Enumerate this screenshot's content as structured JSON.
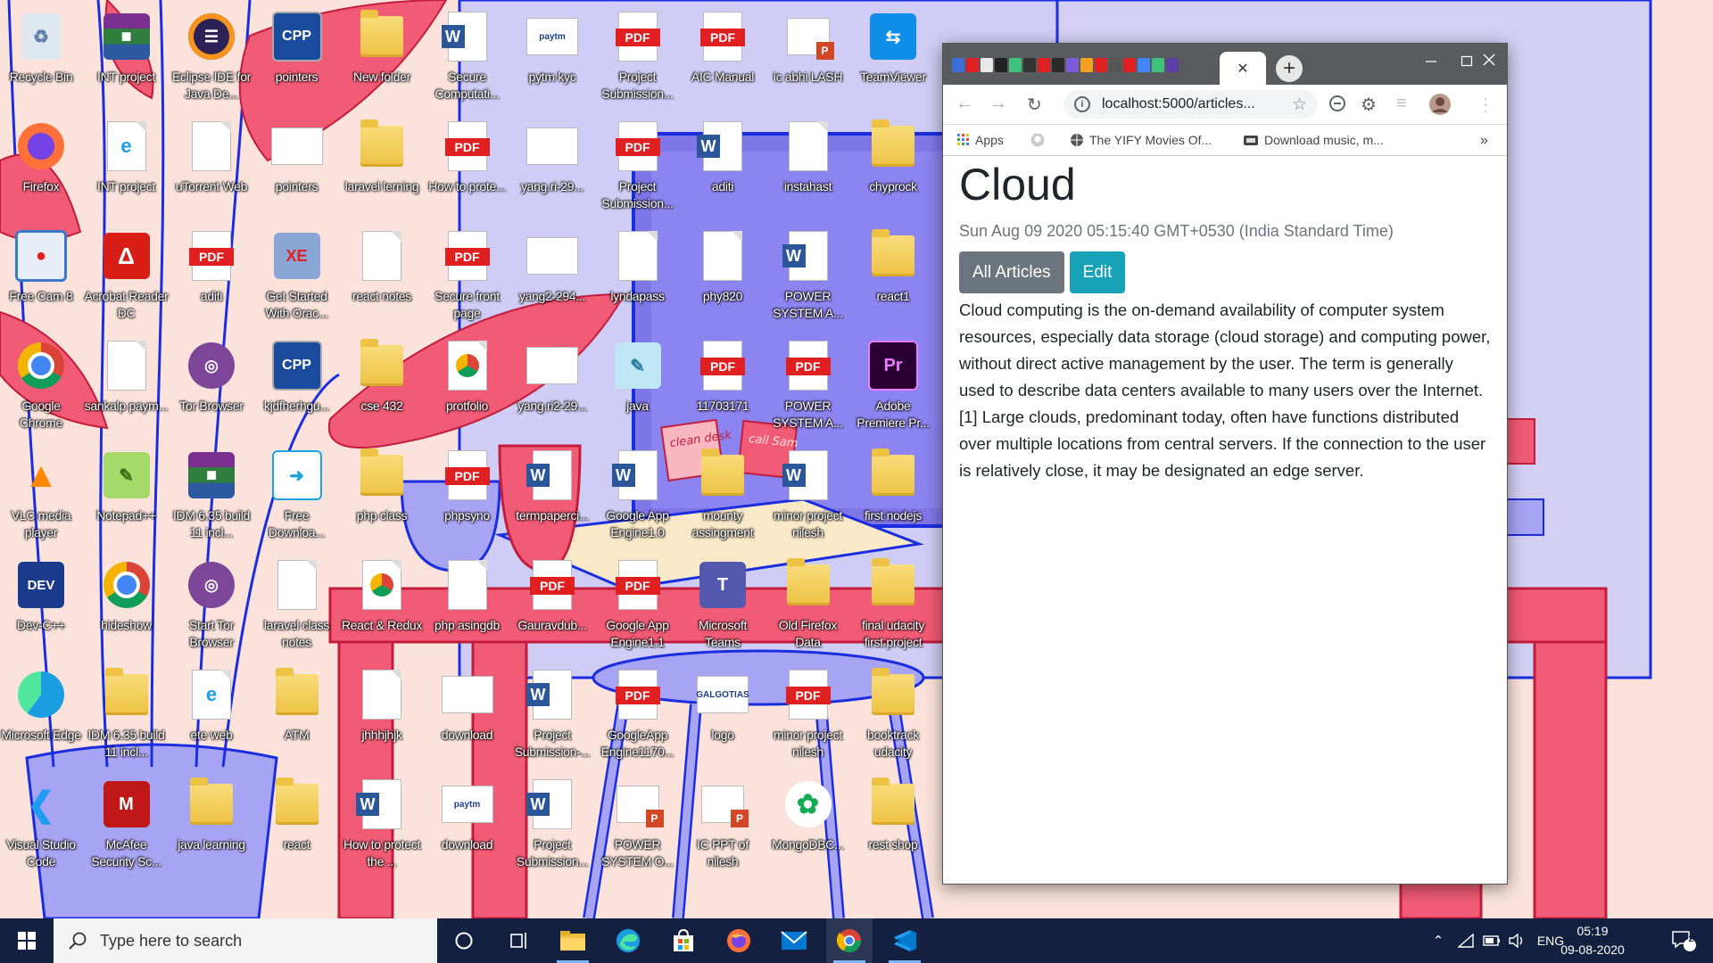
{
  "desktop": {
    "icons": [
      {
        "label": "Recycle Bin",
        "type": "recycle"
      },
      {
        "label": "INT project",
        "type": "winrar"
      },
      {
        "label": "Eclipse IDE for Java De...",
        "type": "eclipse"
      },
      {
        "label": "pointers",
        "type": "cpp"
      },
      {
        "label": "New folder",
        "type": "folder"
      },
      {
        "label": "Secure Computati...",
        "type": "word"
      },
      {
        "label": "pytm kyc",
        "type": "image",
        "glyph_text": "paytm"
      },
      {
        "label": "Project Submission...",
        "type": "pdf"
      },
      {
        "label": "AIC Manual",
        "type": "pdf"
      },
      {
        "label": "ic abhi LASH",
        "type": "ppt"
      },
      {
        "label": "TeamViewer",
        "type": "teamviewer"
      },
      {
        "label": "Firefox",
        "type": "firefox"
      },
      {
        "label": "INT project",
        "type": "edgedoc"
      },
      {
        "label": "uTorrent Web",
        "type": "doc"
      },
      {
        "label": "pointers",
        "type": "image",
        "glyph_text": ""
      },
      {
        "label": "laravel lerning",
        "type": "folder"
      },
      {
        "label": "How to prote...",
        "type": "pdf"
      },
      {
        "label": "yang.ri-29...",
        "type": "image",
        "glyph_text": ""
      },
      {
        "label": "Project Submission...",
        "type": "pdf"
      },
      {
        "label": "aditi",
        "type": "word"
      },
      {
        "label": "instahast",
        "type": "doc"
      },
      {
        "label": "chyprock",
        "type": "folder"
      },
      {
        "label": "Free Cam 8",
        "type": "freecam"
      },
      {
        "label": "Acrobat Reader DC",
        "type": "acrobat"
      },
      {
        "label": "aditi",
        "type": "pdf"
      },
      {
        "label": "Get Started With Orac...",
        "type": "oracle"
      },
      {
        "label": "react notes",
        "type": "doc"
      },
      {
        "label": "Secure front page",
        "type": "pdf"
      },
      {
        "label": "yang2-294...",
        "type": "image",
        "glyph_text": ""
      },
      {
        "label": "lyndapass",
        "type": "doc"
      },
      {
        "label": "phy820",
        "type": "doc"
      },
      {
        "label": "POWER SYSTEM A...",
        "type": "word"
      },
      {
        "label": "react1",
        "type": "folder"
      },
      {
        "label": "Google Chrome",
        "type": "chrome"
      },
      {
        "label": "sankalp paym...",
        "type": "doc"
      },
      {
        "label": "Tor Browser",
        "type": "tor"
      },
      {
        "label": "kjdfherhgu...",
        "type": "cpp"
      },
      {
        "label": "cse 432",
        "type": "folder"
      },
      {
        "label": "protfolio",
        "type": "chromedoc"
      },
      {
        "label": "yang.ri2-29...",
        "type": "image",
        "glyph_text": ""
      },
      {
        "label": "java",
        "type": "notepad"
      },
      {
        "label": "11703171",
        "type": "pdf"
      },
      {
        "label": "POWER SYSTEM A...",
        "type": "pdf"
      },
      {
        "label": "Adobe Premiere Pr...",
        "type": "premiere"
      },
      {
        "label": "VLC media player",
        "type": "vlc"
      },
      {
        "label": "Notepad++",
        "type": "notepadpp"
      },
      {
        "label": "IDM 6.35 build 11 incl...",
        "type": "winrar"
      },
      {
        "label": "Free Downloa...",
        "type": "freedl"
      },
      {
        "label": "php class",
        "type": "folder"
      },
      {
        "label": "phpsyno",
        "type": "pdf"
      },
      {
        "label": "termpaperci...",
        "type": "word"
      },
      {
        "label": "Google App Engine1.0",
        "type": "word"
      },
      {
        "label": "mounty assingment",
        "type": "folder"
      },
      {
        "label": "minor project nilesh",
        "type": "word"
      },
      {
        "label": "first nodejs",
        "type": "folder"
      },
      {
        "label": "Dev-C++",
        "type": "devcpp"
      },
      {
        "label": "hideshow",
        "type": "chrome"
      },
      {
        "label": "Start Tor Browser",
        "type": "tor"
      },
      {
        "label": "laravel class notes",
        "type": "doc"
      },
      {
        "label": "React & Redux",
        "type": "chromedoc"
      },
      {
        "label": "php asingdb",
        "type": "doc"
      },
      {
        "label": "Gauravdub...",
        "type": "pdf"
      },
      {
        "label": "Google App Engine1.1",
        "type": "pdf"
      },
      {
        "label": "Microsoft Teams",
        "type": "teams"
      },
      {
        "label": "Old Firefox Data",
        "type": "folder"
      },
      {
        "label": "final udacity first project",
        "type": "folder"
      },
      {
        "label": "Microsoft Edge",
        "type": "edge"
      },
      {
        "label": "IDM 6.35 build 11 incl...",
        "type": "folder"
      },
      {
        "label": "ete web",
        "type": "edgedoc"
      },
      {
        "label": "ATM",
        "type": "folder"
      },
      {
        "label": "jhhhjhjk",
        "type": "doc"
      },
      {
        "label": "download",
        "type": "image",
        "glyph_text": ""
      },
      {
        "label": "Project Submission-...",
        "type": "word"
      },
      {
        "label": "GoogleApp Engine1170...",
        "type": "pdf"
      },
      {
        "label": "logo",
        "type": "image",
        "glyph_text": "GALGOTIAS"
      },
      {
        "label": "minor project nilesh",
        "type": "pdf"
      },
      {
        "label": "booktrack udacity",
        "type": "folder"
      },
      {
        "label": "Visual Studio Code",
        "type": "vscode"
      },
      {
        "label": "McAfee Security Sc...",
        "type": "mcafee"
      },
      {
        "label": "java learning",
        "type": "folder"
      },
      {
        "label": "react",
        "type": "folder"
      },
      {
        "label": "How to protect the ...",
        "type": "word"
      },
      {
        "label": "download",
        "type": "image",
        "glyph_text": "paytm"
      },
      {
        "label": "Project Submission...",
        "type": "word"
      },
      {
        "label": "POWER SYSTEM O...",
        "type": "ppt"
      },
      {
        "label": "IC PPT of nilesh",
        "type": "ppt"
      },
      {
        "label": "MongoDBC...",
        "type": "mongo"
      },
      {
        "label": "rest shop",
        "type": "folder"
      }
    ],
    "wallpaper_notes": [
      "clean desk",
      "call Sam"
    ]
  },
  "browser": {
    "tab_close": "✕",
    "new_tab": "+",
    "url": "localhost:5000/articles...",
    "bookmarks": [
      {
        "label": "Apps",
        "icon": "apps-grid-icon"
      },
      {
        "label": "",
        "icon": "github-icon"
      },
      {
        "label": "The YIFY Movies Of...",
        "icon": "globe-icon"
      },
      {
        "label": "Download music, m...",
        "icon": "music-site-icon"
      }
    ],
    "bookmarks_more": "»",
    "article": {
      "title": "Cloud",
      "date": "Sun Aug 09 2020 05:15:40 GMT+0530 (India Standard Time)",
      "all_articles_label": "All Articles",
      "edit_label": "Edit",
      "body": "Cloud computing is the on-demand availability of computer system resources, especially data storage (cloud storage) and computing power, without direct active management by the user. The term is generally used to describe data centers available to many users over the Internet.[1] Large clouds, predominant today, often have functions distributed over multiple locations from central servers. If the connection to the user is relatively close, it may be designated an edge server."
    },
    "colors": {
      "secondary": "#6c757d",
      "info": "#17a2b8"
    }
  },
  "taskbar": {
    "search_placeholder": "Type here to search",
    "language": "ENG",
    "time": "05:19",
    "date": "09-08-2020",
    "notifications": "29"
  }
}
